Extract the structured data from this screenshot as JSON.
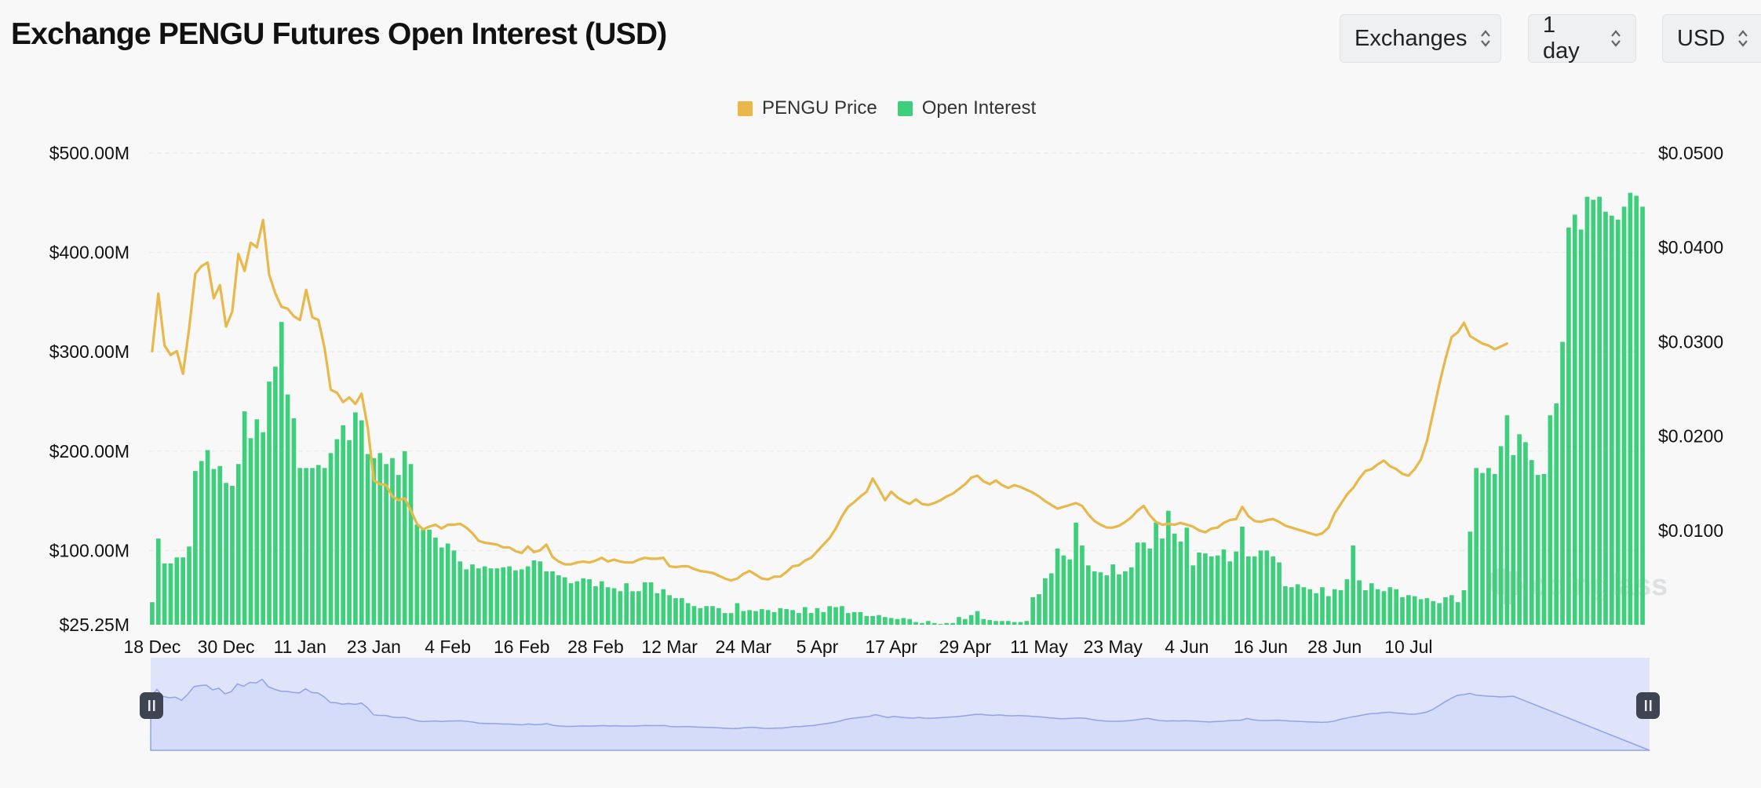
{
  "header": {
    "title": "Exchange PENGU Futures Open Interest (USD)",
    "controls": [
      {
        "label": "Exchanges"
      },
      {
        "label": "1 day"
      },
      {
        "label": "USD"
      }
    ]
  },
  "colors": {
    "price_line": "#e8b84a",
    "open_interest_bar": "#3ecf7c",
    "navigator_fill": "#dfe4fb",
    "navigator_line": "#8fa3e8",
    "handle": "#3f4452"
  },
  "legend": [
    {
      "name": "PENGU Price",
      "color": "#e8b84a"
    },
    {
      "name": "Open Interest",
      "color": "#3ecf7c"
    }
  ],
  "watermark": "coinglass",
  "chart_data": {
    "type": "bar",
    "legend_position": "top-center",
    "grid": true,
    "x_tick_labels": [
      "18 Dec",
      "30 Dec",
      "11 Jan",
      "23 Jan",
      "4 Feb",
      "16 Feb",
      "28 Feb",
      "12 Mar",
      "24 Mar",
      "5 Apr",
      "17 Apr",
      "29 Apr",
      "11 May",
      "23 May",
      "4 Jun",
      "16 Jun",
      "28 Jun",
      "10 Jul"
    ],
    "y_left_tick_labels": [
      "$25.25M",
      "$100.00M",
      "$200.00M",
      "$300.00M",
      "$400.00M",
      "$500.00M"
    ],
    "y_left_tick_values": [
      25.25,
      100,
      200,
      300,
      400,
      500
    ],
    "y_right_tick_labels": [
      "$0.0100",
      "$0.0200",
      "$0.0300",
      "$0.0400",
      "$0.0500"
    ],
    "y_right_tick_values": [
      0.01,
      0.02,
      0.03,
      0.04,
      0.05
    ],
    "y_left_range": [
      25.25,
      500
    ],
    "y_right_range": [
      0,
      0.05
    ],
    "series": [
      {
        "name": "Open Interest",
        "type": "bar",
        "axis": "left",
        "unit": "USD millions",
        "values": [
          48,
          112,
          87,
          87,
          93,
          93,
          104,
          180,
          190,
          201,
          182,
          185,
          168,
          165,
          187,
          240,
          213,
          232,
          219,
          270,
          285,
          330,
          257,
          233,
          183,
          183,
          183,
          186,
          183,
          198,
          212,
          226,
          211,
          239,
          231,
          197,
          193,
          198,
          187,
          193,
          176,
          200,
          187,
          126,
          121,
          121,
          113,
          103,
          107,
          100,
          89,
          81,
          86,
          82,
          84,
          82,
          82,
          83,
          84,
          80,
          81,
          84,
          90,
          89,
          79,
          79,
          75,
          73,
          67,
          69,
          72,
          71,
          64,
          69,
          63,
          62,
          59,
          67,
          59,
          59,
          68,
          68,
          57,
          61,
          55,
          52,
          52,
          47,
          44,
          42,
          44,
          44,
          42,
          37,
          37,
          47,
          39,
          40,
          39,
          41,
          40,
          38,
          42,
          41,
          40,
          37,
          43,
          37,
          42,
          38,
          44,
          43,
          44,
          37,
          38,
          38,
          34,
          34,
          35,
          33,
          32,
          31,
          32,
          31,
          28,
          27,
          29,
          27,
          26,
          27,
          27,
          33,
          31,
          35,
          39,
          31,
          30,
          29,
          29,
          29,
          28,
          28,
          29,
          53,
          56,
          72,
          77,
          102,
          95,
          91,
          128,
          105,
          85,
          79,
          78,
          75,
          86,
          76,
          79,
          83,
          108,
          108,
          102,
          128,
          112,
          140,
          117,
          109,
          123,
          85,
          98,
          97,
          94,
          95,
          101,
          89,
          99,
          124,
          94,
          94,
          100,
          100,
          94,
          88,
          64,
          63,
          66,
          63,
          61,
          57,
          63,
          54,
          61,
          60,
          71,
          105,
          70,
          60,
          67,
          61,
          59,
          63,
          61,
          53,
          55,
          54,
          51,
          52,
          49,
          47,
          53,
          55,
          48,
          60,
          119,
          183,
          178,
          183,
          177,
          205,
          236,
          196,
          217,
          209,
          191,
          176,
          177,
          236,
          248,
          310,
          425,
          438,
          423,
          456,
          453,
          456,
          441,
          437,
          433,
          446,
          460,
          457,
          446
        ]
      },
      {
        "name": "PENGU Price",
        "type": "line",
        "axis": "right",
        "unit": "USD",
        "values": [
          0.029,
          0.0351,
          0.0296,
          0.0286,
          0.029,
          0.0266,
          0.0314,
          0.0372,
          0.038,
          0.0384,
          0.0346,
          0.036,
          0.0316,
          0.0332,
          0.0393,
          0.0375,
          0.0405,
          0.04,
          0.0429,
          0.0371,
          0.0351,
          0.0337,
          0.0335,
          0.0327,
          0.0323,
          0.0355,
          0.0326,
          0.0323,
          0.0293,
          0.0249,
          0.0246,
          0.0236,
          0.0241,
          0.0234,
          0.0245,
          0.0209,
          0.0153,
          0.0149,
          0.0148,
          0.0136,
          0.0132,
          0.0134,
          0.0121,
          0.0107,
          0.0101,
          0.0104,
          0.0106,
          0.0102,
          0.0106,
          0.0106,
          0.0107,
          0.0103,
          0.0097,
          0.0089,
          0.0087,
          0.0086,
          0.0085,
          0.0082,
          0.0082,
          0.0078,
          0.0076,
          0.0083,
          0.0077,
          0.0079,
          0.0085,
          0.0072,
          0.0067,
          0.0064,
          0.0064,
          0.0066,
          0.0067,
          0.0066,
          0.0068,
          0.0071,
          0.0067,
          0.0069,
          0.0067,
          0.0066,
          0.0066,
          0.0069,
          0.0071,
          0.007,
          0.007,
          0.0071,
          0.0062,
          0.0061,
          0.0062,
          0.0062,
          0.0059,
          0.0057,
          0.0056,
          0.0055,
          0.0052,
          0.0049,
          0.0047,
          0.0049,
          0.0054,
          0.0057,
          0.0053,
          0.0049,
          0.0048,
          0.0051,
          0.0051,
          0.0056,
          0.0062,
          0.0063,
          0.0068,
          0.0071,
          0.0078,
          0.0085,
          0.0092,
          0.0102,
          0.0115,
          0.0125,
          0.013,
          0.0136,
          0.0141,
          0.0155,
          0.0144,
          0.0132,
          0.0141,
          0.0135,
          0.0131,
          0.0128,
          0.0133,
          0.0128,
          0.0127,
          0.0129,
          0.0132,
          0.0136,
          0.0139,
          0.0144,
          0.0149,
          0.0156,
          0.0158,
          0.0152,
          0.0149,
          0.0153,
          0.0148,
          0.0145,
          0.0148,
          0.0146,
          0.0143,
          0.014,
          0.0136,
          0.0131,
          0.0127,
          0.0123,
          0.0125,
          0.0127,
          0.0129,
          0.0126,
          0.0117,
          0.011,
          0.0106,
          0.0103,
          0.0103,
          0.0105,
          0.0109,
          0.0114,
          0.0121,
          0.0126,
          0.0116,
          0.0109,
          0.0106,
          0.0107,
          0.0106,
          0.0108,
          0.0106,
          0.0104,
          0.01,
          0.0098,
          0.0102,
          0.0103,
          0.0108,
          0.0111,
          0.0112,
          0.0125,
          0.0115,
          0.011,
          0.0109,
          0.0111,
          0.0112,
          0.0109,
          0.0105,
          0.0103,
          0.0101,
          0.0099,
          0.0097,
          0.0095,
          0.0097,
          0.0103,
          0.0118,
          0.0128,
          0.0138,
          0.0145,
          0.0155,
          0.0163,
          0.0165,
          0.017,
          0.0174,
          0.0168,
          0.0165,
          0.016,
          0.0158,
          0.0165,
          0.0175,
          0.0195,
          0.0225,
          0.0255,
          0.0282,
          0.0305,
          0.031,
          0.032,
          0.0306,
          0.0302,
          0.0298,
          0.0296,
          0.0292,
          0.0295,
          0.0298
        ]
      }
    ]
  }
}
